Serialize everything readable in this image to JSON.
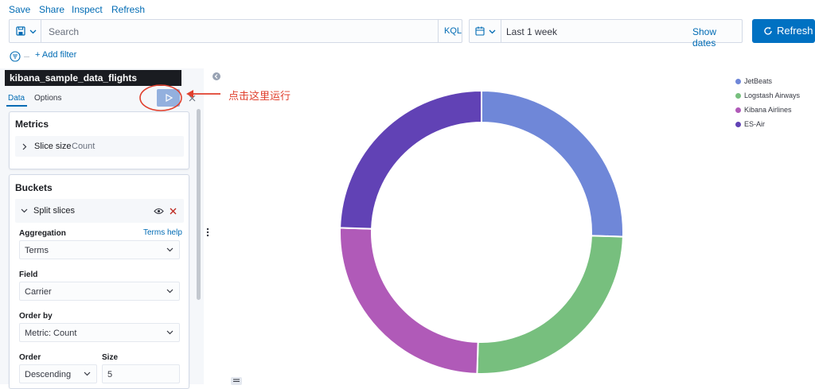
{
  "top_menu": {
    "save": "Save",
    "share": "Share",
    "inspect": "Inspect",
    "refresh": "Refresh"
  },
  "query": {
    "search_placeholder": "Search",
    "language": "KQL",
    "time_range": "Last 1 week",
    "show_dates": "Show dates",
    "refresh_button": "Refresh"
  },
  "filter": {
    "add_filter": "+ Add filter"
  },
  "editor": {
    "index_pattern": "kibana_sample_data_flights",
    "tabs": [
      "Data",
      "Options"
    ],
    "annotation": "点击这里运行",
    "metrics": {
      "title": "Metrics",
      "item_prefix": "Slice size",
      "item_value": "Count"
    },
    "buckets": {
      "title": "Buckets",
      "split": "Split slices",
      "aggregation_label": "Aggregation",
      "terms_help": "Terms help",
      "aggregation_value": "Terms",
      "field_label": "Field",
      "field_value": "Carrier",
      "order_by_label": "Order by",
      "order_by_value": "Metric: Count",
      "order_label": "Order",
      "order_value": "Descending",
      "size_label": "Size",
      "size_value": "5"
    }
  },
  "chart_data": {
    "type": "pie",
    "donut": true,
    "categories": [
      "JetBeats",
      "Logstash Airways",
      "Kibana Airlines",
      "ES-Air"
    ],
    "values": [
      25.5,
      25.0,
      25.0,
      24.5
    ],
    "colors": [
      "#6f87d8",
      "#77bf7e",
      "#b05ab8",
      "#6142b5"
    ],
    "legend": "top-right"
  }
}
